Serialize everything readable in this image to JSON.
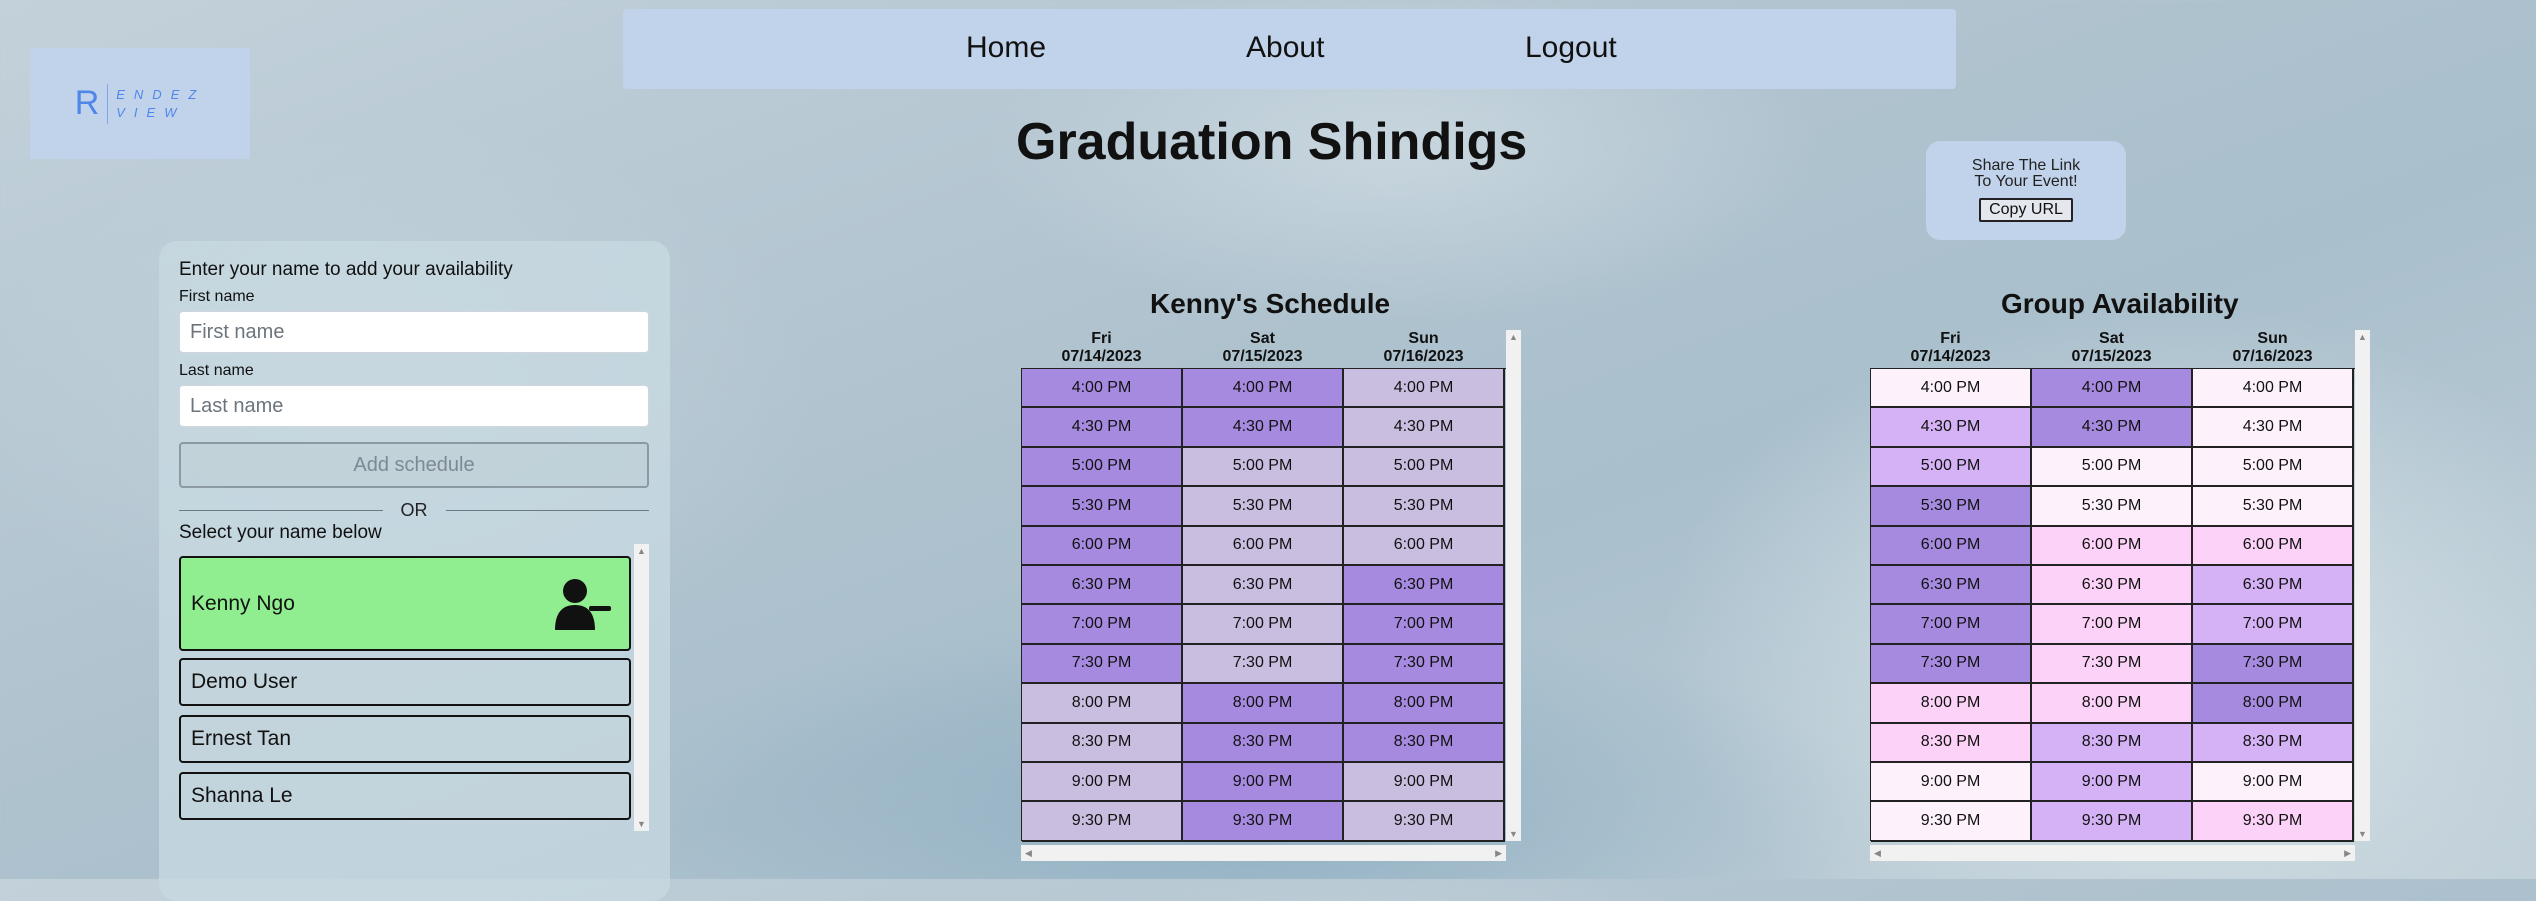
{
  "logo": {
    "letter": "R",
    "line1": "ENDEZ",
    "line2": "VIEW"
  },
  "nav": {
    "home": "Home",
    "about": "About",
    "logout": "Logout"
  },
  "page": {
    "title": "Graduation Shindigs"
  },
  "share": {
    "line1": "Share The Link",
    "line2": "To Your Event!",
    "button": "Copy URL"
  },
  "form": {
    "prompt": "Enter your name to add your availability",
    "first_label": "First name",
    "first_placeholder": "First name",
    "last_label": "Last name",
    "last_placeholder": "Last name",
    "add_button": "Add schedule",
    "or": "OR",
    "select_label": "Select your name below",
    "users": [
      "Kenny Ngo",
      "Demo User",
      "Ernest Tan",
      "Shanna Le"
    ],
    "selected_user": "Kenny Ngo"
  },
  "colors": {
    "selected_user": "#90ee90",
    "personal_available": "#a68ae0",
    "personal_unavailable": "#c9bde0",
    "group_levels": [
      "#fdf2fb",
      "#fcd2f8",
      "#d5b1f6",
      "#a68ae0"
    ]
  },
  "personal": {
    "title": "Kenny's Schedule",
    "days": [
      {
        "dow": "Fri",
        "date": "07/14/2023"
      },
      {
        "dow": "Sat",
        "date": "07/15/2023"
      },
      {
        "dow": "Sun",
        "date": "07/16/2023"
      }
    ],
    "times": [
      "4:00 PM",
      "4:30 PM",
      "5:00 PM",
      "5:30 PM",
      "6:00 PM",
      "6:30 PM",
      "7:00 PM",
      "7:30 PM",
      "8:00 PM",
      "8:30 PM",
      "9:00 PM",
      "9:30 PM"
    ],
    "available": [
      [
        1,
        1,
        0
      ],
      [
        1,
        1,
        0
      ],
      [
        1,
        0,
        0
      ],
      [
        1,
        0,
        0
      ],
      [
        1,
        0,
        0
      ],
      [
        1,
        0,
        1
      ],
      [
        1,
        0,
        1
      ],
      [
        1,
        0,
        1
      ],
      [
        0,
        1,
        1
      ],
      [
        0,
        1,
        1
      ],
      [
        0,
        1,
        0
      ],
      [
        0,
        1,
        0
      ]
    ]
  },
  "group": {
    "title": "Group Availability",
    "days": [
      {
        "dow": "Fri",
        "date": "07/14/2023"
      },
      {
        "dow": "Sat",
        "date": "07/15/2023"
      },
      {
        "dow": "Sun",
        "date": "07/16/2023"
      }
    ],
    "times": [
      "4:00 PM",
      "4:30 PM",
      "5:00 PM",
      "5:30 PM",
      "6:00 PM",
      "6:30 PM",
      "7:00 PM",
      "7:30 PM",
      "8:00 PM",
      "8:30 PM",
      "9:00 PM",
      "9:30 PM"
    ],
    "levels": [
      [
        0,
        3,
        0
      ],
      [
        2,
        3,
        0
      ],
      [
        2,
        0,
        0
      ],
      [
        3,
        0,
        0
      ],
      [
        3,
        1,
        1
      ],
      [
        3,
        1,
        2
      ],
      [
        3,
        1,
        2
      ],
      [
        3,
        1,
        3
      ],
      [
        1,
        1,
        3
      ],
      [
        1,
        2,
        2
      ],
      [
        0,
        2,
        0
      ],
      [
        0,
        2,
        1
      ]
    ]
  }
}
